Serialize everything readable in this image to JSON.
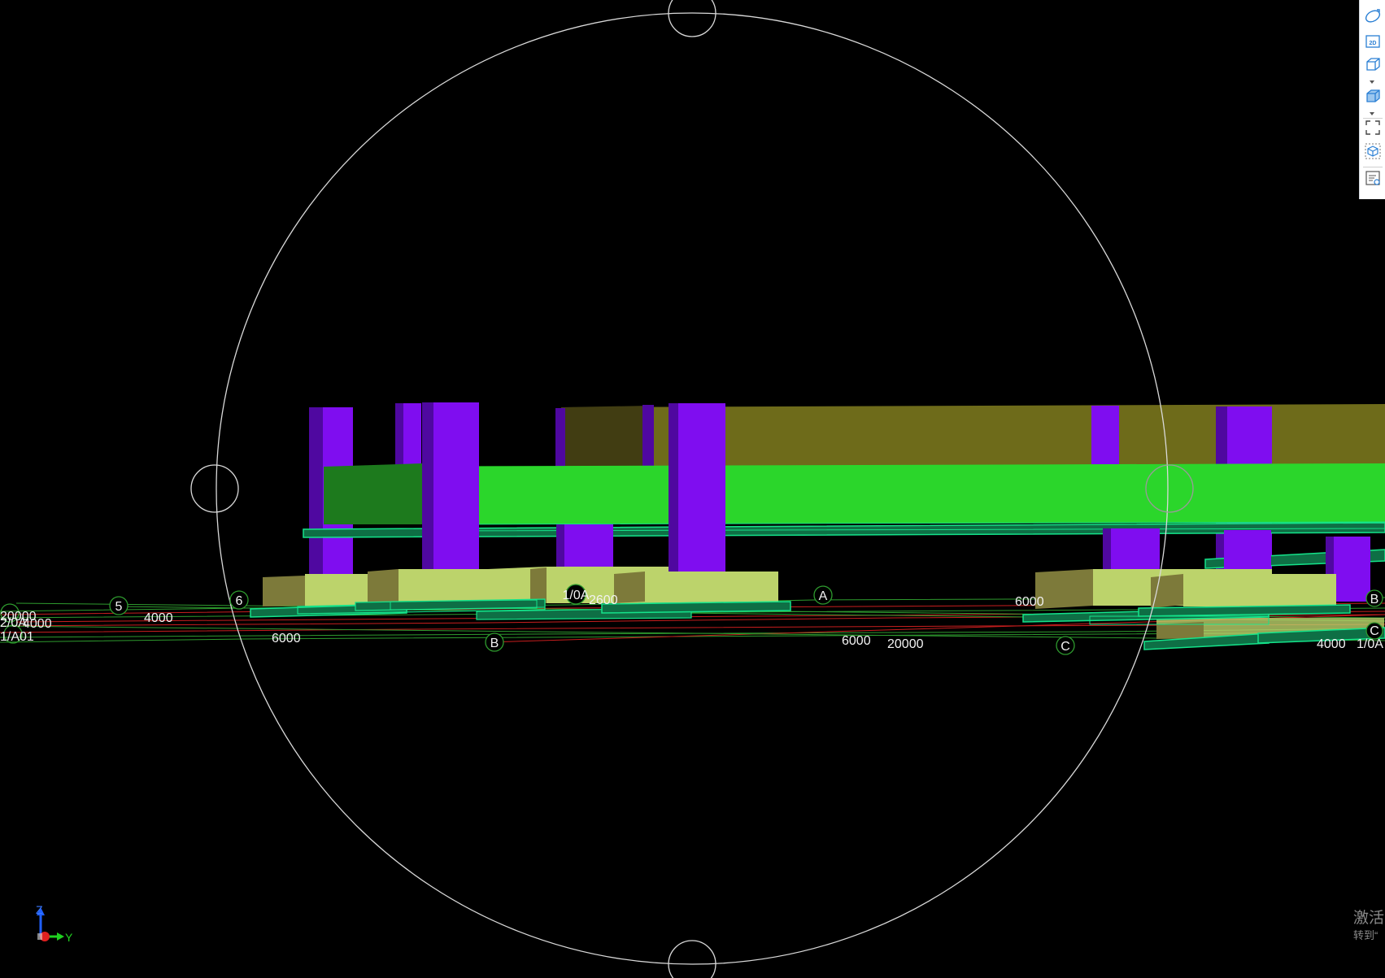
{
  "viewport": {
    "background": "#000000",
    "colors": {
      "column": "#7f0df0",
      "column_side": "#4f08a0",
      "beam": "#2bd62b",
      "beam_dark": "#1d7a1d",
      "wall": "#6e6b1a",
      "wall_dark": "#413d12",
      "footing": "#bcd36b",
      "footing_dark": "#7d7a3a",
      "slab_outline": "#14e38a",
      "axis_line_red": "#c81e1e",
      "axis_line_green": "#2e9b2e",
      "orbit_circle": "#d9d9d9"
    }
  },
  "grid_axes": {
    "axis_5": "5",
    "axis_6": "6",
    "axis_a": "A",
    "axis_b": "B",
    "axis_c": "C",
    "axis_1_0a": "1/0A",
    "axis_b_right": "B",
    "axis_c_right": "C"
  },
  "dimensions": {
    "d_20000_left": "20000",
    "d_4000_left": "4000",
    "d_2_0a": "2/0A",
    "d_1_a01": "1/A01",
    "d_4000": "4000",
    "d_6000_left": "6000",
    "d_2600": "2600",
    "d_6000_mid": "6000",
    "d_20000": "20000",
    "d_6000_right": "6000",
    "d_4000_right": "4000",
    "d_1_0a_right": "1/0A"
  },
  "axis_indicator": {
    "z_label": "Z",
    "y_label": "Y",
    "x_color": "#e02020",
    "y_color": "#20d020",
    "z_color": "#2060ff"
  },
  "toolbar": {
    "tools": [
      {
        "name": "orbit-tool",
        "icon": "orbit-icon"
      },
      {
        "name": "2d-view-tool",
        "icon": "2d-view-icon",
        "text": "2D"
      },
      {
        "name": "3d-view-tool",
        "icon": "cube-outline-icon"
      },
      {
        "name": "shaded-view-tool",
        "icon": "cube-shaded-icon"
      },
      {
        "name": "zoom-extents-tool",
        "icon": "zoom-extents-icon"
      },
      {
        "name": "view-cube-tool",
        "icon": "view-cube-icon"
      },
      {
        "name": "properties-tool",
        "icon": "properties-list-icon"
      }
    ],
    "accent": "#2a7fd4"
  },
  "watermark": {
    "line1": "激活",
    "line2": "转到“"
  }
}
